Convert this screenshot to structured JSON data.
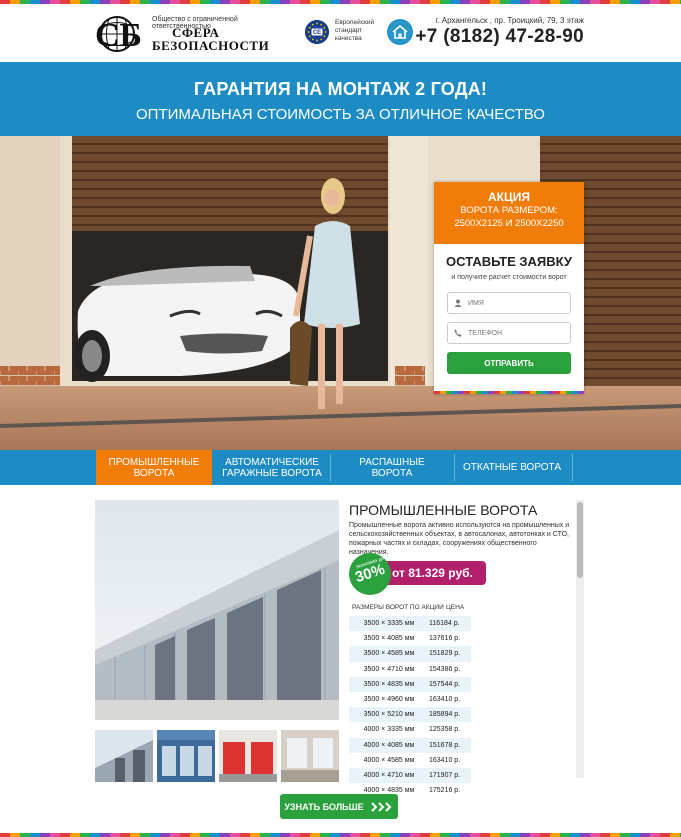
{
  "header": {
    "company_small": "Общество с ограниченной ответственностью",
    "company_name_1": "СФЕРА",
    "company_name_2": "БЕЗОПАСНОСТИ",
    "logo_letters": "СБ",
    "ce_mark": "CE",
    "ce_text": "Европейский стандарт качества",
    "address": "г. Архангельск , пр. Троицкий, 79, 3 этаж",
    "phone": "+7 (8182) 47-28-90"
  },
  "banner": {
    "title": "ГАРАНТИЯ НА МОНТАЖ 2 ГОДА!",
    "subtitle": "ОПТИМАЛЬНАЯ СТОИМОСТЬ ЗА ОТЛИЧНОЕ КАЧЕСТВО"
  },
  "form": {
    "promo_title": "АКЦИЯ",
    "promo_line1": "ВОРОТА РАЗМЕРОМ:",
    "promo_line2": "2500Х2125 И 2500Х2250",
    "title": "ОСТАВЬТЕ ЗАЯВКУ",
    "subtitle": "и получите расчет стоимости ворот",
    "name_placeholder": "ИМЯ",
    "phone_placeholder": "ТЕЛЕФОН",
    "submit_label": "ОТПРАВИТЬ"
  },
  "tabs": [
    {
      "label": "ПРОМЫШЛЕННЫЕ ВОРОТА",
      "active": true
    },
    {
      "label": "АВТОМАТИЧЕСКИЕ ГАРАЖНЫЕ ВОРОТА",
      "active": false
    },
    {
      "label": "РАСПАШНЫЕ ВОРОТА",
      "active": false
    },
    {
      "label": "ОТКАТНЫЕ ВОРОТА",
      "active": false
    }
  ],
  "product": {
    "title": "ПРОМЫШЛЕННЫЕ ВОРОТА",
    "description": "Промышленные ворота активно используются на промышленных и сельскохозяйственных объектах, в автосалонах, автотонках и СТО, пожарных частях и складах, сооружениях общественного назначения.",
    "discount_small": "экономия до",
    "discount": "30%",
    "price_from": "от 81.329 руб.",
    "col_sizes": "РАЗМЕРЫ ВОРОТ ПО АКЦИИ",
    "col_price": "ЦЕНА",
    "rows": [
      {
        "size": "3500 × 3335 мм",
        "price": "116184 р."
      },
      {
        "size": "3500 × 4085 мм",
        "price": "137616 р."
      },
      {
        "size": "3500 × 4585 мм",
        "price": "151829 р."
      },
      {
        "size": "3500 × 4710 мм",
        "price": "154386 р."
      },
      {
        "size": "3500 × 4835 мм",
        "price": "157544 р."
      },
      {
        "size": "3500 × 4960 мм",
        "price": "163410 р."
      },
      {
        "size": "3500 × 5210 мм",
        "price": "185894 р."
      },
      {
        "size": "4000 × 3335 мм",
        "price": "125358 р."
      },
      {
        "size": "4000 × 4085 мм",
        "price": "151678 р."
      },
      {
        "size": "4000 × 4585 мм",
        "price": "163410 р."
      },
      {
        "size": "4000 × 4710 мм",
        "price": "171907 р."
      },
      {
        "size": "4000 × 4835 мм",
        "price": "175216 р."
      }
    ],
    "more_label": "УЗНАТЬ БОЛЬШЕ"
  },
  "icons": [
    "logo-icon",
    "ce-icon",
    "home-icon",
    "user-icon",
    "phone-icon",
    "chevrons-right-icon"
  ],
  "colors": {
    "brand_blue": "#1d8cc4",
    "accent_orange": "#f07d0a",
    "green": "#2aa13c",
    "magenta": "#b2206b"
  }
}
